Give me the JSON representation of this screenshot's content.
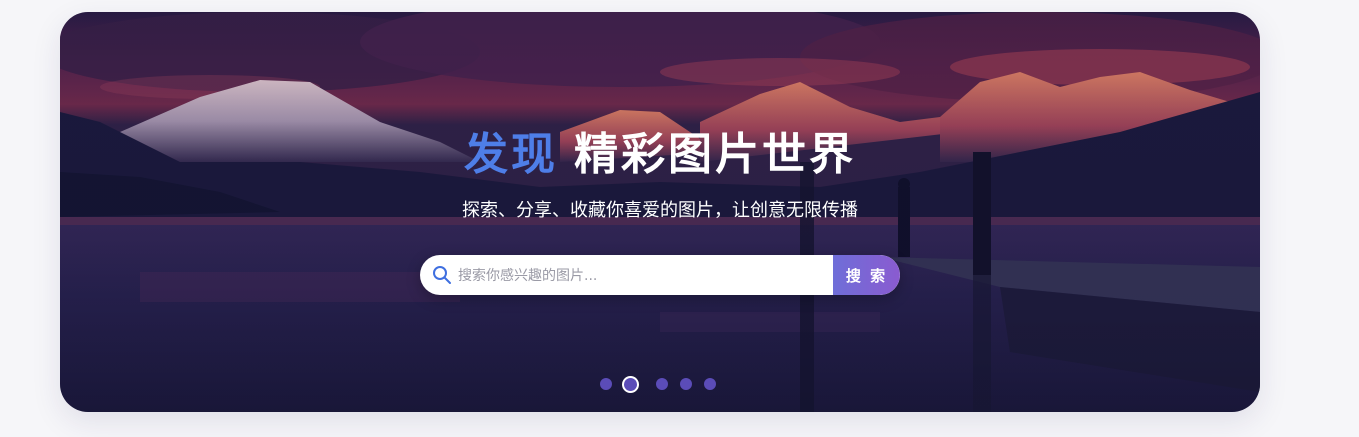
{
  "hero": {
    "title_accent": "发现",
    "title_main": "精彩图片世界",
    "subtitle": "探索、分享、收藏你喜爱的图片，让创意无限传播",
    "background_image": "mountain lake dock at sunset"
  },
  "search": {
    "placeholder": "搜索你感兴趣的图片...",
    "value": "",
    "button_label": "搜 索",
    "icon": "search-icon"
  },
  "carousel": {
    "total": 5,
    "active_index": 1
  },
  "colors": {
    "accent": "#4e7ee8",
    "button_start": "#6f6ed8",
    "button_end": "#8a5bd0",
    "dot": "#5b4cb8"
  }
}
